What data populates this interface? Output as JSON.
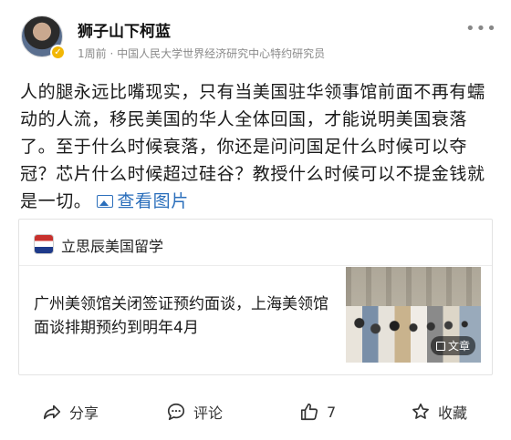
{
  "author": {
    "name": "狮子山下柯蓝",
    "meta": "1周前 · 中国人民大学世界经济研究中心特约研究员",
    "more_icon": "more-dots-icon"
  },
  "post": {
    "text": "人的腿永远比嘴现实，只有当美国驻华领事馆前面不再有蠕动的人流，移民美国的华人全体回国，才能说明美国衰落了。至于什么时候衰落，你还是问问国足什么时候可以夺冠？芯片什么时候超过硅谷？教授什么时候可以不提金钱就是一切。",
    "view_images_label": "查看图片"
  },
  "card": {
    "source_name": "立思辰美国留学",
    "title": "广州美领馆关闭签证预约面谈，上海美领馆面谈排期预约到明年4月",
    "thumb_badge": "文章"
  },
  "actions": {
    "share_label": "分享",
    "comment_label": "评论",
    "like_count": "7",
    "favorite_label": "收藏"
  },
  "colors": {
    "link": "#2a6ebb",
    "meta": "#8a8a8a",
    "verify_badge": "#f2b705"
  }
}
